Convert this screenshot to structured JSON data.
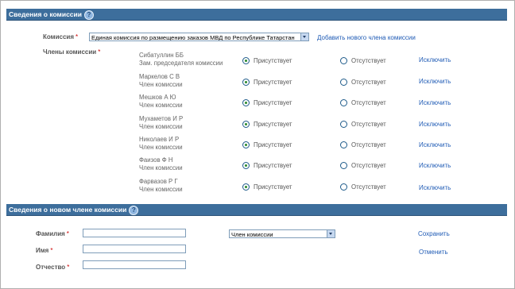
{
  "commission_section": {
    "title": "Сведения о комиссии"
  },
  "commission_field": {
    "label": "Комиссия",
    "required_mark": "*",
    "selected_value": "Единая комиссия по размещению заказов МВД по Республике Татарстан",
    "add_member_link": "Добавить нового члена комиссии"
  },
  "members_field": {
    "label": "Члены комиссии",
    "required_mark": "*"
  },
  "attendance": {
    "present_label": "Присутствует",
    "absent_label": "Отсутствует",
    "exclude_label": "Исключить"
  },
  "members": [
    {
      "name": "Сибатуллин ББ",
      "role": "Зам. председателя комиссии",
      "present": true
    },
    {
      "name": "Маркелов С В",
      "role": "Член комиссии",
      "present": true
    },
    {
      "name": "Мешков А Ю",
      "role": "Член комиссии",
      "present": true
    },
    {
      "name": "Мухаметов И Р",
      "role": "Член комиссии",
      "present": true
    },
    {
      "name": "Николаев И Р",
      "role": "Член комиссии",
      "present": true
    },
    {
      "name": "Фаизов Ф Н",
      "role": "Член комиссии",
      "present": true
    },
    {
      "name": "Фарвазов Р Г",
      "role": "Член комиссии",
      "present": true
    }
  ],
  "new_member_section": {
    "title": "Сведения о новом члене комиссии"
  },
  "new_member_form": {
    "surname_label": "Фамилия",
    "name_label": "Имя",
    "patronymic_label": "Отчество",
    "required_mark": "*",
    "surname_value": "",
    "name_value": "",
    "patronymic_value": "",
    "role_selected": "Член комиссии",
    "save_label": "Сохранить",
    "cancel_label": "Отменить"
  },
  "colors": {
    "header_bg": "#3d6e9c",
    "link": "#1f5bb5",
    "required": "#cc0000",
    "radio_selected": "#2a8a2a"
  }
}
